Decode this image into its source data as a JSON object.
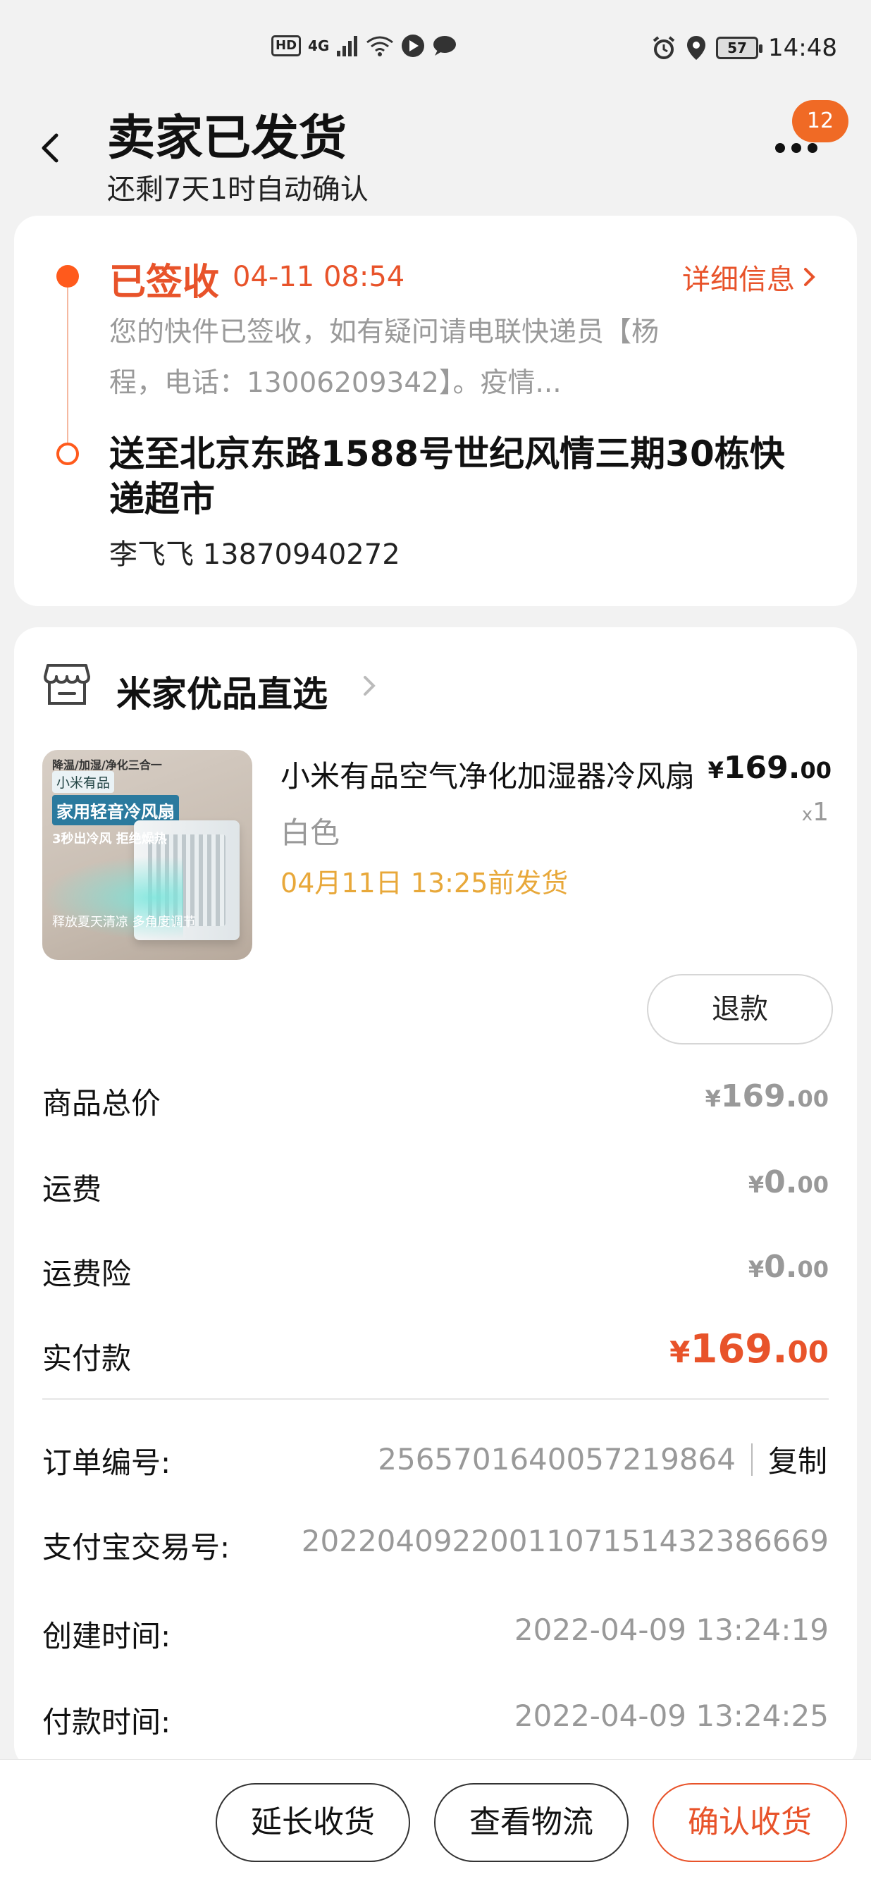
{
  "status_bar": {
    "hd": "HD",
    "network": "4G",
    "battery": "57",
    "time": "14:48"
  },
  "header": {
    "title": "卖家已发货",
    "subtitle": "还剩7天1时自动确认",
    "badge": "12"
  },
  "logistics": {
    "status": "已签收",
    "status_time": "04-11 08:54",
    "detail_link": "详细信息",
    "description": "您的快件已签收，如有疑问请电联快递员【杨程，电话：13006209342】。疫情...",
    "address": "送至北京东路1588号世纪风情三期30栋快递超市",
    "recipient": "李飞飞 13870940272"
  },
  "shop": {
    "name": "米家优品直选"
  },
  "product": {
    "image_text_brand": "小米有品",
    "image_text_tag": "降温/加湿/净化三合一",
    "image_text_title": "家用轻音冷风扇",
    "image_text_feature1": "3秒出冷风 拒绝燥热",
    "image_text_feature2": "释放夏天清凉 多角度调节",
    "title": "小米有品空气净化加湿器冷风扇",
    "price_symbol": "¥",
    "price_main": "169.",
    "price_cents": "00",
    "qty_x": "x",
    "qty": "1",
    "spec": "白色",
    "ship_by": "04月11日 13:25前发货",
    "refund_label": "退款"
  },
  "summary": {
    "rows": [
      {
        "label": "商品总价",
        "symbol": "¥",
        "main": "169.",
        "cents": "00"
      },
      {
        "label": "运费",
        "symbol": "¥",
        "main": "0.",
        "cents": "00"
      },
      {
        "label": "运费险",
        "symbol": "¥",
        "main": "0.",
        "cents": "00"
      },
      {
        "label": "实付款",
        "symbol": "¥",
        "main": "169.",
        "cents": "00"
      }
    ]
  },
  "order_info": {
    "order_no_label": "订单编号:",
    "order_no": "2565701640057219864",
    "copy_label": "复制",
    "alipay_label": "支付宝交易号:",
    "alipay_no": "2022040922001107151432386669",
    "created_label": "创建时间:",
    "created_time": "2022-04-09 13:24:19",
    "paid_label": "付款时间:",
    "paid_time": "2022-04-09 13:24:25"
  },
  "actions": {
    "extend": "延长收货",
    "logistics": "查看物流",
    "confirm": "确认收货"
  },
  "colors": {
    "accent": "#e8532a",
    "badge": "#f06a25",
    "ship_text": "#e8a83a",
    "muted": "#999999"
  }
}
